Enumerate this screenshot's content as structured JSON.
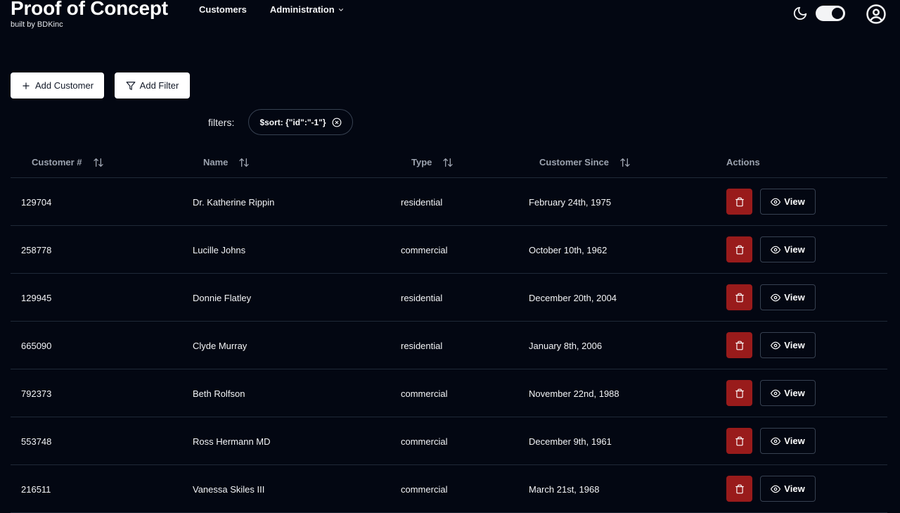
{
  "brand": {
    "title": "Proof of Concept",
    "subtitle": "built by BDKinc"
  },
  "nav": {
    "customers": "Customers",
    "administration": "Administration"
  },
  "toolbar": {
    "add_customer": "Add Customer",
    "add_filter": "Add Filter"
  },
  "filters": {
    "label": "filters:",
    "chip": "$sort: {\"id\":\"-1\"}"
  },
  "table": {
    "headers": {
      "customer_no": "Customer #",
      "name": "Name",
      "type": "Type",
      "customer_since": "Customer Since",
      "actions": "Actions"
    },
    "view_label": "View",
    "rows": [
      {
        "id": "129704",
        "name": "Dr. Katherine Rippin",
        "type": "residential",
        "since": "February 24th, 1975"
      },
      {
        "id": "258778",
        "name": "Lucille Johns",
        "type": "commercial",
        "since": "October 10th, 1962"
      },
      {
        "id": "129945",
        "name": "Donnie Flatley",
        "type": "residential",
        "since": "December 20th, 2004"
      },
      {
        "id": "665090",
        "name": "Clyde Murray",
        "type": "residential",
        "since": "January 8th, 2006"
      },
      {
        "id": "792373",
        "name": "Beth Rolfson",
        "type": "commercial",
        "since": "November 22nd, 1988"
      },
      {
        "id": "553748",
        "name": "Ross Hermann MD",
        "type": "commercial",
        "since": "December 9th, 1961"
      },
      {
        "id": "216511",
        "name": "Vanessa Skiles III",
        "type": "commercial",
        "since": "March 21st, 1968"
      }
    ]
  },
  "theme": {
    "dark_mode": true,
    "delete_color": "#991b1b",
    "background": "#030712"
  }
}
